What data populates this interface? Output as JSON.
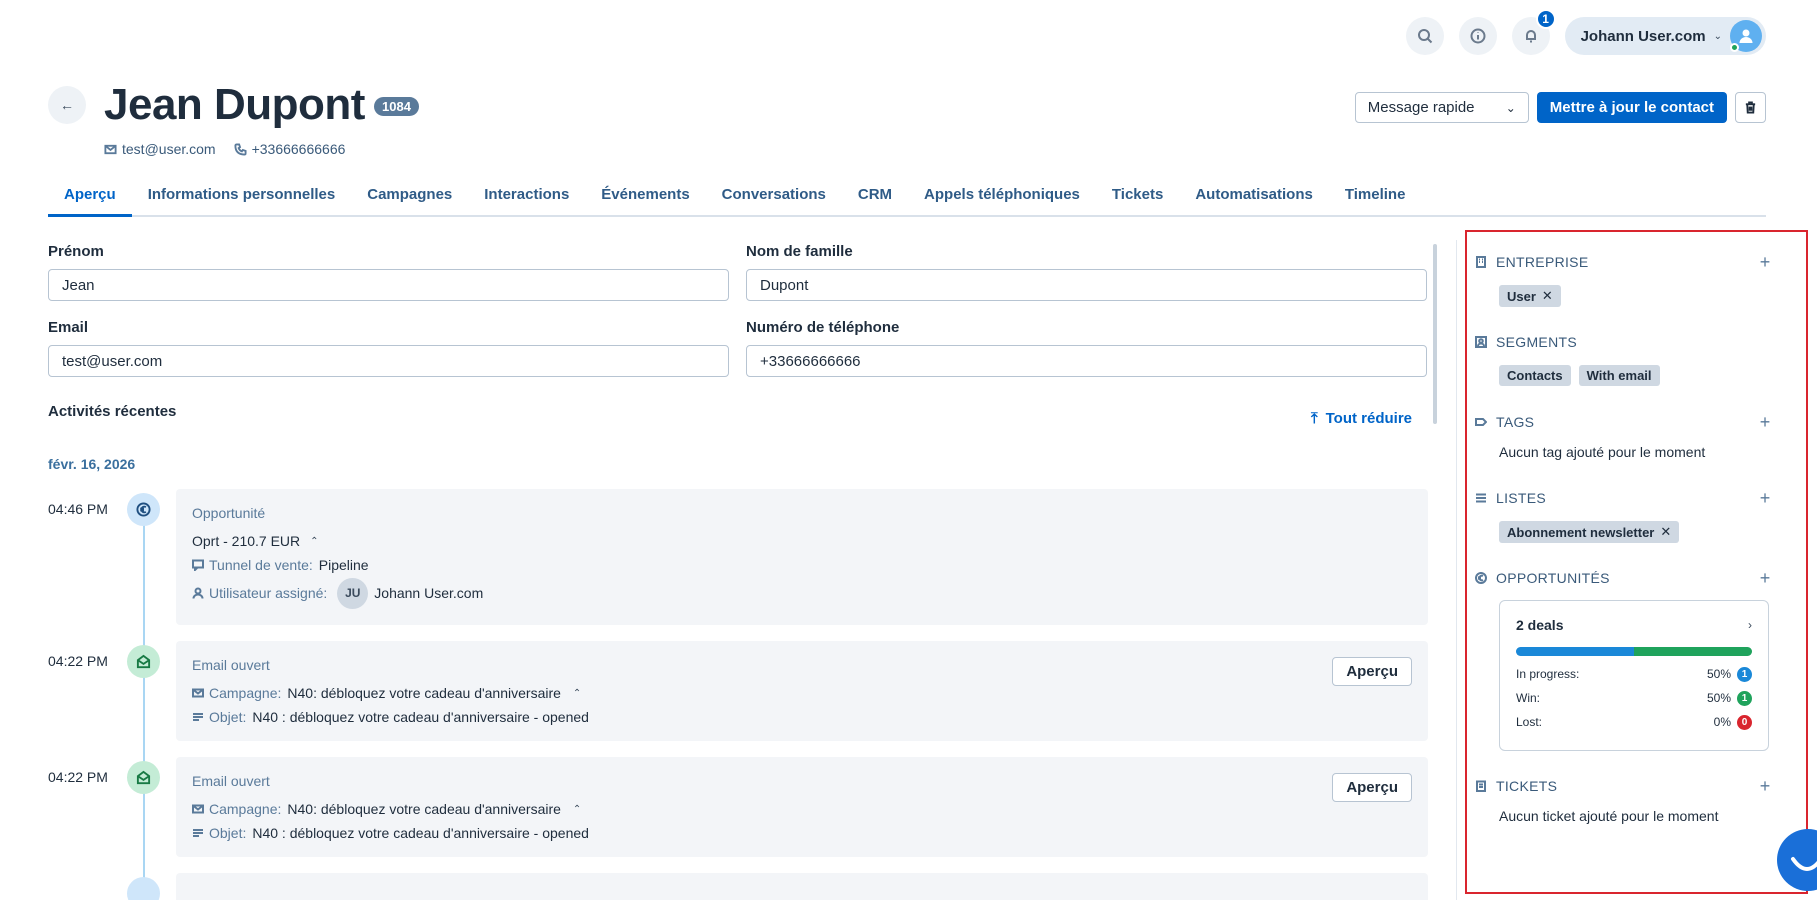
{
  "topbar": {
    "notifications_count": "1",
    "user_name": "Johann User.com"
  },
  "contact": {
    "name": "Jean Dupont",
    "id": "1084",
    "email": "test@user.com",
    "phone": "+33666666666"
  },
  "actions": {
    "quick_message": "Message rapide",
    "update_contact": "Mettre à jour le contact"
  },
  "tabs": [
    {
      "label": "Aperçu",
      "active": true
    },
    {
      "label": "Informations personnelles"
    },
    {
      "label": "Campagnes"
    },
    {
      "label": "Interactions"
    },
    {
      "label": "Événements"
    },
    {
      "label": "Conversations"
    },
    {
      "label": "CRM"
    },
    {
      "label": "Appels téléphoniques"
    },
    {
      "label": "Tickets"
    },
    {
      "label": "Automatisations"
    },
    {
      "label": "Timeline"
    }
  ],
  "form": {
    "first_name_label": "Prénom",
    "first_name_value": "Jean",
    "last_name_label": "Nom de famille",
    "last_name_value": "Dupont",
    "email_label": "Email",
    "email_value": "test@user.com",
    "phone_label": "Numéro de téléphone",
    "phone_value": "+33666666666"
  },
  "activities": {
    "title": "Activités récentes",
    "collapse_all": "Tout réduire",
    "date": "févr. 16, 2026",
    "items": [
      {
        "time": "04:46 PM",
        "kind": "Opportunité",
        "headline": "Oprt - 210.7 EUR",
        "pipeline_label": "Tunnel de vente:",
        "pipeline_value": "Pipeline",
        "assignee_label": "Utilisateur assigné:",
        "assignee_initials": "JU",
        "assignee_name": "Johann User.com"
      },
      {
        "time": "04:22 PM",
        "kind": "Email ouvert",
        "campaign_label": "Campagne:",
        "campaign_value": "N40: débloquez votre cadeau d'anniversaire",
        "subject_label": "Objet:",
        "subject_value": "N40 : débloquez votre cadeau d'anniversaire - opened",
        "button": "Aperçu"
      },
      {
        "time": "04:22 PM",
        "kind": "Email ouvert",
        "campaign_label": "Campagne:",
        "campaign_value": "N40: débloquez votre cadeau d'anniversaire",
        "subject_label": "Objet:",
        "subject_value": "N40 : débloquez votre cadeau d'anniversaire - opened",
        "button": "Aperçu"
      }
    ]
  },
  "sidebar": {
    "company": {
      "title": "ENTREPRISE",
      "chips": [
        "User"
      ]
    },
    "segments": {
      "title": "SEGMENTS",
      "chips": [
        "Contacts",
        "With email"
      ]
    },
    "tags": {
      "title": "TAGS",
      "empty": "Aucun tag ajouté pour le moment"
    },
    "lists": {
      "title": "LISTES",
      "chips": [
        "Abonnement newsletter"
      ]
    },
    "opportunities": {
      "title": "OPPORTUNITÉS",
      "deals_label": "2 deals",
      "in_progress_label": "In progress:",
      "in_progress_pct": "50%",
      "in_progress_count": "1",
      "win_label": "Win:",
      "win_pct": "50%",
      "win_count": "1",
      "lost_label": "Lost:",
      "lost_pct": "0%",
      "lost_count": "0"
    },
    "tickets": {
      "title": "TICKETS",
      "empty": "Aucun ticket ajouté pour le moment"
    }
  },
  "colors": {
    "primary": "#0064c8",
    "in_progress": "#1a88d8",
    "win": "#1fa35c",
    "lost": "#d9252e",
    "highlight_border": "#d9252e"
  }
}
